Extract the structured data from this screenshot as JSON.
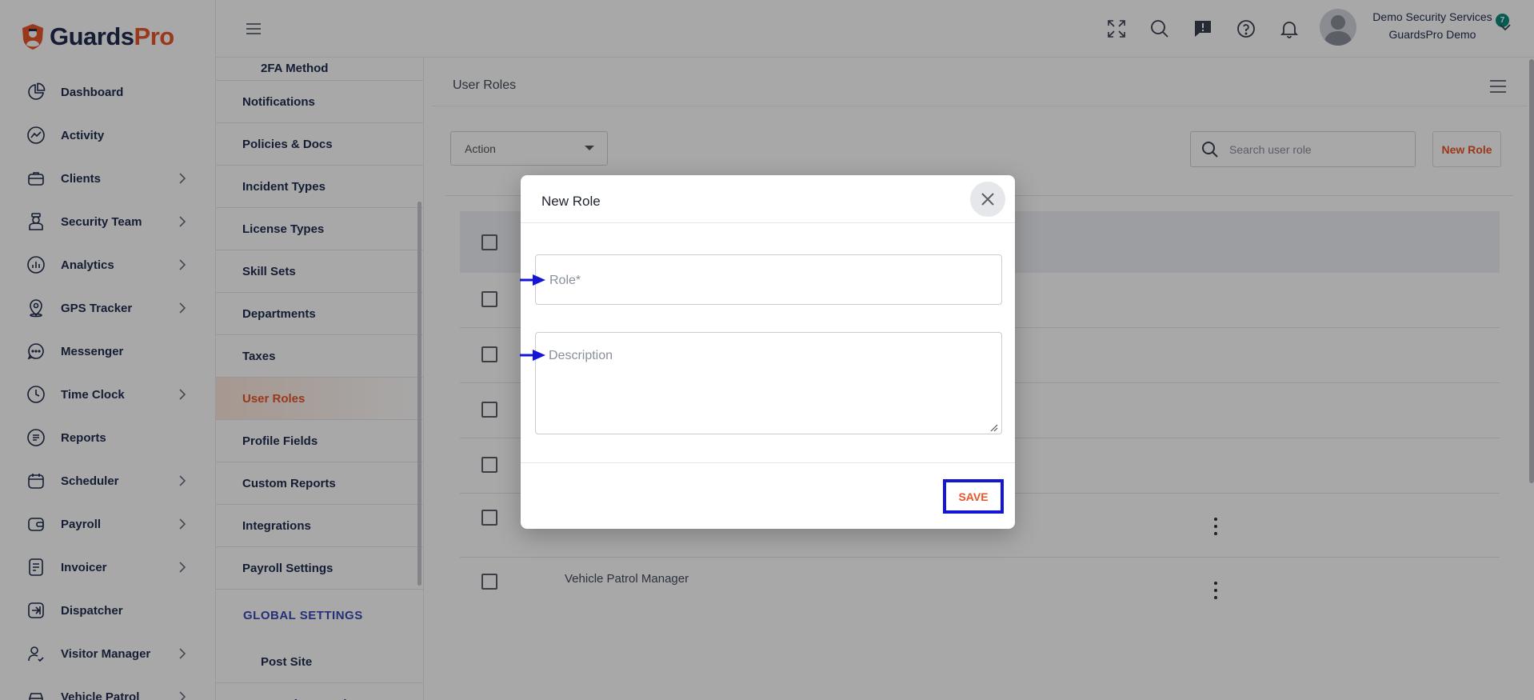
{
  "app": {
    "brand_part1": "Guards",
    "brand_part2": "Pro",
    "brand_color": "#e8552a",
    "navy_color": "#1f2d4e"
  },
  "sidebar": {
    "items": [
      {
        "label": "Dashboard",
        "icon": "pie-chart-icon",
        "has_children": false
      },
      {
        "label": "Activity",
        "icon": "activity-icon",
        "has_children": false
      },
      {
        "label": "Clients",
        "icon": "briefcase-icon",
        "has_children": true
      },
      {
        "label": "Security Team",
        "icon": "guard-icon",
        "has_children": true
      },
      {
        "label": "Analytics",
        "icon": "analytics-icon",
        "has_children": true
      },
      {
        "label": "GPS Tracker",
        "icon": "map-pin-icon",
        "has_children": true
      },
      {
        "label": "Messenger",
        "icon": "chat-icon",
        "has_children": false
      },
      {
        "label": "Time Clock",
        "icon": "clock-icon",
        "has_children": true
      },
      {
        "label": "Reports",
        "icon": "report-icon",
        "has_children": false
      },
      {
        "label": "Scheduler",
        "icon": "calendar-icon",
        "has_children": true
      },
      {
        "label": "Payroll",
        "icon": "wallet-icon",
        "has_children": true
      },
      {
        "label": "Invoicer",
        "icon": "invoice-icon",
        "has_children": true
      },
      {
        "label": "Dispatcher",
        "icon": "dispatch-icon",
        "has_children": false
      },
      {
        "label": "Visitor Manager",
        "icon": "visitor-icon",
        "has_children": true
      },
      {
        "label": "Vehicle Patrol",
        "icon": "car-icon",
        "has_children": true
      }
    ]
  },
  "submenu": {
    "top_item": "2FA Method",
    "items": [
      {
        "label": "Notifications",
        "active": false
      },
      {
        "label": "Policies & Docs",
        "active": false
      },
      {
        "label": "Incident Types",
        "active": false
      },
      {
        "label": "License Types",
        "active": false
      },
      {
        "label": "Skill Sets",
        "active": false
      },
      {
        "label": "Departments",
        "active": false
      },
      {
        "label": "Taxes",
        "active": false
      },
      {
        "label": "User Roles",
        "active": true
      },
      {
        "label": "Profile Fields",
        "active": false
      },
      {
        "label": "Custom Reports",
        "active": false
      },
      {
        "label": "Integrations",
        "active": false
      },
      {
        "label": "Payroll Settings",
        "active": false
      }
    ],
    "section_title": "GLOBAL SETTINGS",
    "section_items": [
      "Post Site",
      "Security Guards"
    ]
  },
  "topbar": {
    "notification_count": "7",
    "badge_color": "#0d8a7a",
    "user_name": "Demo Security Services",
    "user_org": "GuardsPro Demo"
  },
  "main": {
    "title": "User Roles",
    "action_label": "Action",
    "search_placeholder": "Search user role",
    "new_role_label": "New Role",
    "rows": [
      {
        "name": ""
      },
      {
        "name": ""
      },
      {
        "name": ""
      },
      {
        "name": ""
      },
      {
        "name": ""
      },
      {
        "name": "Vehicle Patrol Manager"
      }
    ]
  },
  "modal": {
    "title": "New Role",
    "role_placeholder": "Role*",
    "description_placeholder": "Description",
    "save_label": "SAVE",
    "highlight_color": "#1515d6"
  }
}
